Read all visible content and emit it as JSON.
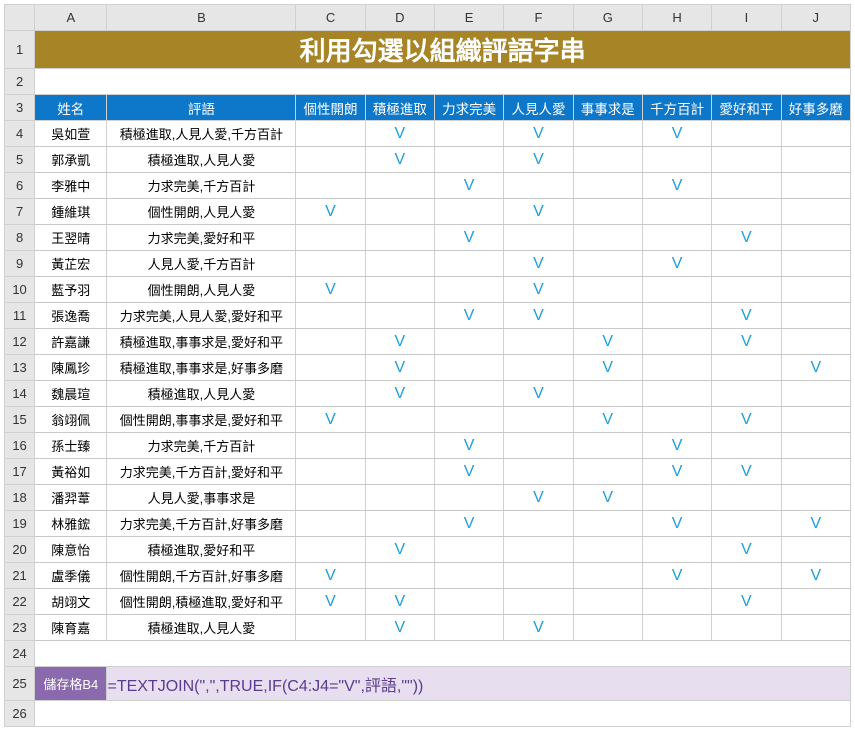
{
  "columns": [
    "A",
    "B",
    "C",
    "D",
    "E",
    "F",
    "G",
    "H",
    "I",
    "J"
  ],
  "title": "利用勾選以組織評語字串",
  "headers": {
    "name": "姓名",
    "comment": "評語",
    "traits": [
      "個性開朗",
      "積極進取",
      "力求完美",
      "人見人愛",
      "事事求是",
      "千方百計",
      "愛好和平",
      "好事多磨"
    ]
  },
  "tick": "V",
  "rows": [
    {
      "name": "吳如萱",
      "comment": "積極進取,人見人愛,千方百計",
      "marks": [
        0,
        1,
        0,
        1,
        0,
        1,
        0,
        0
      ]
    },
    {
      "name": "郭承凱",
      "comment": "積極進取,人見人愛",
      "marks": [
        0,
        1,
        0,
        1,
        0,
        0,
        0,
        0
      ]
    },
    {
      "name": "李雅中",
      "comment": "力求完美,千方百計",
      "marks": [
        0,
        0,
        1,
        0,
        0,
        1,
        0,
        0
      ]
    },
    {
      "name": "鍾維琪",
      "comment": "個性開朗,人見人愛",
      "marks": [
        1,
        0,
        0,
        1,
        0,
        0,
        0,
        0
      ]
    },
    {
      "name": "王翌晴",
      "comment": "力求完美,愛好和平",
      "marks": [
        0,
        0,
        1,
        0,
        0,
        0,
        1,
        0
      ]
    },
    {
      "name": "黃芷宏",
      "comment": "人見人愛,千方百計",
      "marks": [
        0,
        0,
        0,
        1,
        0,
        1,
        0,
        0
      ]
    },
    {
      "name": "藍予羽",
      "comment": "個性開朗,人見人愛",
      "marks": [
        1,
        0,
        0,
        1,
        0,
        0,
        0,
        0
      ]
    },
    {
      "name": "張逸喬",
      "comment": "力求完美,人見人愛,愛好和平",
      "marks": [
        0,
        0,
        1,
        1,
        0,
        0,
        1,
        0
      ]
    },
    {
      "name": "許嘉謙",
      "comment": "積極進取,事事求是,愛好和平",
      "marks": [
        0,
        1,
        0,
        0,
        1,
        0,
        1,
        0
      ]
    },
    {
      "name": "陳鳳珍",
      "comment": "積極進取,事事求是,好事多磨",
      "marks": [
        0,
        1,
        0,
        0,
        1,
        0,
        0,
        1
      ]
    },
    {
      "name": "魏晨瑄",
      "comment": "積極進取,人見人愛",
      "marks": [
        0,
        1,
        0,
        1,
        0,
        0,
        0,
        0
      ]
    },
    {
      "name": "翁翊佩",
      "comment": "個性開朗,事事求是,愛好和平",
      "marks": [
        1,
        0,
        0,
        0,
        1,
        0,
        1,
        0
      ]
    },
    {
      "name": "孫士臻",
      "comment": "力求完美,千方百計",
      "marks": [
        0,
        0,
        1,
        0,
        0,
        1,
        0,
        0
      ]
    },
    {
      "name": "黃裕如",
      "comment": "力求完美,千方百計,愛好和平",
      "marks": [
        0,
        0,
        1,
        0,
        0,
        1,
        1,
        0
      ]
    },
    {
      "name": "潘羿葦",
      "comment": "人見人愛,事事求是",
      "marks": [
        0,
        0,
        0,
        1,
        1,
        0,
        0,
        0
      ]
    },
    {
      "name": "林雅鋐",
      "comment": "力求完美,千方百計,好事多磨",
      "marks": [
        0,
        0,
        1,
        0,
        0,
        1,
        0,
        1
      ]
    },
    {
      "name": "陳意怡",
      "comment": "積極進取,愛好和平",
      "marks": [
        0,
        1,
        0,
        0,
        0,
        0,
        1,
        0
      ]
    },
    {
      "name": "盧季儀",
      "comment": "個性開朗,千方百計,好事多磨",
      "marks": [
        1,
        0,
        0,
        0,
        0,
        1,
        0,
        1
      ]
    },
    {
      "name": "胡翊文",
      "comment": "個性開朗,積極進取,愛好和平",
      "marks": [
        1,
        1,
        0,
        0,
        0,
        0,
        1,
        0
      ]
    },
    {
      "name": "陳育嘉",
      "comment": "積極進取,人見人愛",
      "marks": [
        0,
        1,
        0,
        1,
        0,
        0,
        0,
        0
      ]
    }
  ],
  "formula": {
    "label": "儲存格B4",
    "text": "=TEXTJOIN(\",\",TRUE,IF(C4:J4=\"V\",評語,\"\"))"
  },
  "chart_data": {
    "type": "table",
    "title": "利用勾選以組織評語字串",
    "columns": [
      "姓名",
      "評語",
      "個性開朗",
      "積極進取",
      "力求完美",
      "人見人愛",
      "事事求是",
      "千方百計",
      "愛好和平",
      "好事多磨"
    ],
    "rows": [
      [
        "吳如萱",
        "積極進取,人見人愛,千方百計",
        "",
        "V",
        "",
        "V",
        "",
        "V",
        "",
        ""
      ],
      [
        "郭承凱",
        "積極進取,人見人愛",
        "",
        "V",
        "",
        "V",
        "",
        "",
        "",
        ""
      ],
      [
        "李雅中",
        "力求完美,千方百計",
        "",
        "",
        "V",
        "",
        "",
        "V",
        "",
        ""
      ],
      [
        "鍾維琪",
        "個性開朗,人見人愛",
        "V",
        "",
        "",
        "V",
        "",
        "",
        "",
        ""
      ],
      [
        "王翌晴",
        "力求完美,愛好和平",
        "",
        "",
        "V",
        "",
        "",
        "",
        "V",
        ""
      ],
      [
        "黃芷宏",
        "人見人愛,千方百計",
        "",
        "",
        "",
        "V",
        "",
        "V",
        "",
        ""
      ],
      [
        "藍予羽",
        "個性開朗,人見人愛",
        "V",
        "",
        "",
        "V",
        "",
        "",
        "",
        ""
      ],
      [
        "張逸喬",
        "力求完美,人見人愛,愛好和平",
        "",
        "",
        "V",
        "V",
        "",
        "",
        "V",
        ""
      ],
      [
        "許嘉謙",
        "積極進取,事事求是,愛好和平",
        "",
        "V",
        "",
        "",
        "V",
        "",
        "V",
        ""
      ],
      [
        "陳鳳珍",
        "積極進取,事事求是,好事多磨",
        "",
        "V",
        "",
        "",
        "V",
        "",
        "",
        "V"
      ],
      [
        "魏晨瑄",
        "積極進取,人見人愛",
        "",
        "V",
        "",
        "V",
        "",
        "",
        "",
        ""
      ],
      [
        "翁翊佩",
        "個性開朗,事事求是,愛好和平",
        "V",
        "",
        "",
        "",
        "V",
        "",
        "V",
        ""
      ],
      [
        "孫士臻",
        "力求完美,千方百計",
        "",
        "",
        "V",
        "",
        "",
        "V",
        "",
        ""
      ],
      [
        "黃裕如",
        "力求完美,千方百計,愛好和平",
        "",
        "",
        "V",
        "",
        "",
        "V",
        "V",
        ""
      ],
      [
        "潘羿葦",
        "人見人愛,事事求是",
        "",
        "",
        "",
        "V",
        "V",
        "",
        "",
        ""
      ],
      [
        "林雅鋐",
        "力求完美,千方百計,好事多磨",
        "",
        "",
        "V",
        "",
        "",
        "V",
        "",
        "V"
      ],
      [
        "陳意怡",
        "積極進取,愛好和平",
        "",
        "V",
        "",
        "",
        "",
        "",
        "V",
        ""
      ],
      [
        "盧季儀",
        "個性開朗,千方百計,好事多磨",
        "V",
        "",
        "",
        "",
        "",
        "V",
        "",
        "V"
      ],
      [
        "胡翊文",
        "個性開朗,積極進取,愛好和平",
        "V",
        "V",
        "",
        "",
        "",
        "",
        "V",
        ""
      ],
      [
        "陳育嘉",
        "積極進取,人見人愛",
        "",
        "V",
        "",
        "V",
        "",
        "",
        "",
        ""
      ]
    ]
  }
}
